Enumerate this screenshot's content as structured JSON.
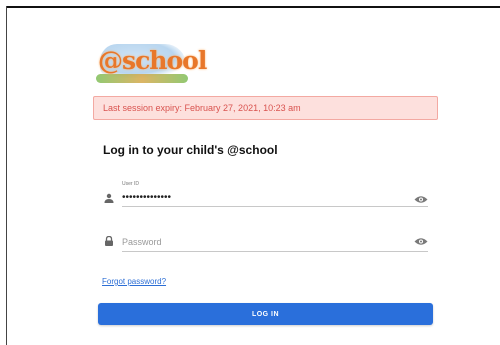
{
  "logo": {
    "text": "@school"
  },
  "session_alert": {
    "text": "Last session expiry: February 27, 2021, 10:23 am"
  },
  "login": {
    "title": "Log in to your child's @school",
    "user_id_label": "User ID",
    "user_id_value": "••••••••••••••",
    "password_placeholder": "Password",
    "forgot_password": "Forgot password?",
    "login_button": "LOG IN"
  },
  "colors": {
    "primary": "#2a6fdb",
    "alert_background": "#fde0dd",
    "alert_text": "#d9534f",
    "link": "#2c6ed5"
  },
  "icons": [
    "person-icon",
    "lock-icon",
    "eye-icon"
  ]
}
